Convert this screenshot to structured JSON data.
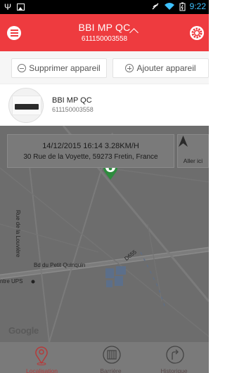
{
  "statusbar": {
    "time": "9:22"
  },
  "header": {
    "device_name": "BBI MP QC",
    "device_id": "611150003558"
  },
  "actions": {
    "delete_label": "Supprimer appareil",
    "add_label": "Ajouter appareil"
  },
  "device_row": {
    "name": "BBI MP QC",
    "id": "611150003558"
  },
  "map": {
    "info_datetime_speed": "14/12/2015 16:14 3.28KM/H",
    "info_address": "30 Rue de la Voyette, 59273 Fretin, France",
    "goto_label": "Aller ici",
    "streets": {
      "louviere": "Rue de la Louvière",
      "petit_quinquin": "Bd du Petit Quinquin",
      "d655": "D655",
      "ups": "ntre UPS",
      "r": "R"
    },
    "google_logo": "Google"
  },
  "bottomnav": {
    "tabs": [
      {
        "label": "Localisation",
        "icon": "location-pin-icon",
        "active": true
      },
      {
        "label": "Barrière",
        "icon": "fence-icon",
        "active": false
      },
      {
        "label": "Historique",
        "icon": "history-route-icon",
        "active": false
      }
    ]
  },
  "colors": {
    "accent": "#ee3b3f",
    "map_overlay": "#6d6d6d",
    "marker": "#2e8b3e"
  }
}
